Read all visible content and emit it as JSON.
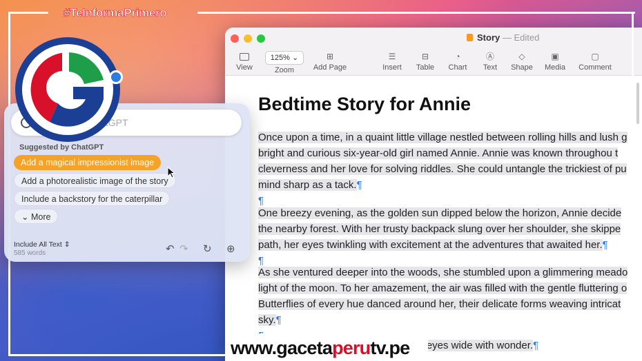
{
  "branding": {
    "hashtag": "#TeInformaPrimero",
    "url_prefix": "www.gaceta",
    "url_highlight": "peru",
    "url_suffix": "tv.pe",
    "colors": {
      "red": "#d8102a",
      "navy": "#1c3f96",
      "blue": "#2c7be0",
      "green": "#1f9e4a"
    }
  },
  "window": {
    "title": "Story",
    "title_sep": "—",
    "status": "Edited",
    "traffic_lights": [
      "#fe5f57",
      "#febc2e",
      "#28c840"
    ]
  },
  "toolbar": {
    "items": [
      {
        "label": "View",
        "icon": "sidebar-icon"
      },
      {
        "label": "Zoom",
        "value": "125%",
        "icon": "chevron-down-icon"
      },
      {
        "label": "Add Page",
        "icon": "add-page-icon"
      },
      {
        "label": "Insert",
        "icon": "insert-icon"
      },
      {
        "label": "Table",
        "icon": "table-icon"
      },
      {
        "label": "Chart",
        "icon": "chart-icon"
      },
      {
        "label": "Text",
        "icon": "text-icon"
      },
      {
        "label": "Shape",
        "icon": "shape-icon"
      },
      {
        "label": "Media",
        "icon": "media-icon"
      },
      {
        "label": "Comment",
        "icon": "comment-icon"
      }
    ]
  },
  "document": {
    "title": "Bedtime Story for Annie",
    "p1": [
      "Once upon a time, in a quaint little village nestled between rolling hills and lush g",
      "bright and curious six-year-old girl named Annie. Annie was known throughou t",
      "cleverness and her love for solving riddles. She could untangle the trickiest of pu",
      "mind sharp as a tack."
    ],
    "p2": [
      "One breezy evening, as the golden sun dipped below the horizon, Annie decide",
      "the nearby forest. With her trusty backpack slung over her shoulder, she skippe",
      "path, her eyes twinkling with excitement at the adventures that awaited her."
    ],
    "p3": [
      "As she ventured deeper into the woods, she stumbled upon a glimmering meado",
      "light of the moon. To her amazement, the air was filled with the gentle fluttering o",
      "Butterflies of every hue danced around her, their delicate forms weaving intricat",
      "sky."
    ],
    "p4": "\"Wow!\" Annie whispered in awe, her eyes wide with wonder.",
    "pilcrow": "¶"
  },
  "writing_tools": {
    "refine_placeholder": "Refine with ChatGPT",
    "suggested_label": "Suggested by ChatGPT",
    "suggestions": [
      "Add a magical impressionist image",
      "Add a photorealistic image of the story",
      "Include a backstory for the caterpillar"
    ],
    "more_label": "More",
    "include_label": "Include All Text",
    "word_count": "585 words",
    "accent_color": "#f5a228"
  }
}
